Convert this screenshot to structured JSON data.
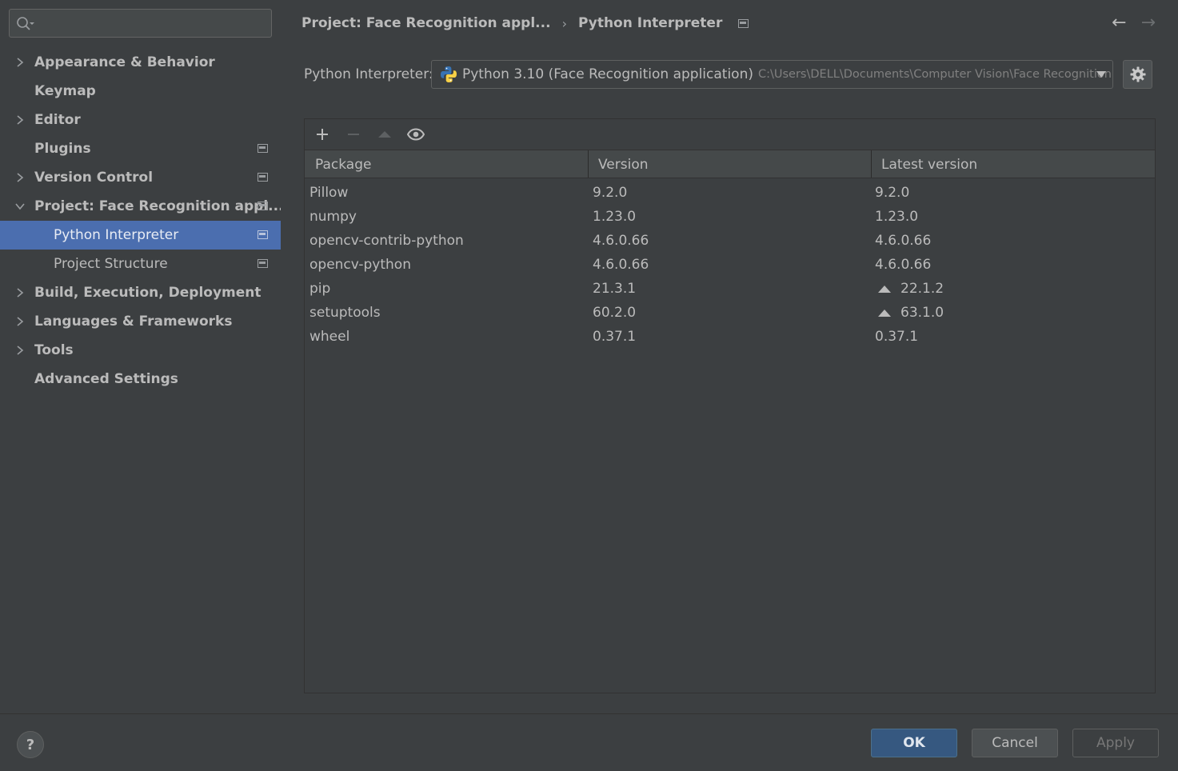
{
  "search": {
    "placeholder": "",
    "value": ""
  },
  "sidebar": {
    "items": [
      {
        "label": "Appearance & Behavior"
      },
      {
        "label": "Keymap"
      },
      {
        "label": "Editor"
      },
      {
        "label": "Plugins"
      },
      {
        "label": "Version Control"
      },
      {
        "label": "Project: Face Recognition appl..."
      },
      {
        "label": "Python Interpreter"
      },
      {
        "label": "Project Structure"
      },
      {
        "label": "Build, Execution, Deployment"
      },
      {
        "label": "Languages & Frameworks"
      },
      {
        "label": "Tools"
      },
      {
        "label": "Advanced Settings"
      }
    ]
  },
  "breadcrumb": {
    "parent": "Project: Face Recognition appl...",
    "current": "Python Interpreter"
  },
  "interpreter": {
    "label": "Python Interpreter:",
    "name": "Python 3.10 (Face Recognition application)",
    "path": "C:\\Users\\DELL\\Documents\\Computer Vision\\Face Recognition a"
  },
  "table": {
    "headers": {
      "package": "Package",
      "version": "Version",
      "latest": "Latest version"
    },
    "rows": [
      {
        "package": "Pillow",
        "version": "9.2.0",
        "latest": "9.2.0",
        "upgrade": false
      },
      {
        "package": "numpy",
        "version": "1.23.0",
        "latest": "1.23.0",
        "upgrade": false
      },
      {
        "package": "opencv-contrib-python",
        "version": "4.6.0.66",
        "latest": "4.6.0.66",
        "upgrade": false
      },
      {
        "package": "opencv-python",
        "version": "4.6.0.66",
        "latest": "4.6.0.66",
        "upgrade": false
      },
      {
        "package": "pip",
        "version": "21.3.1",
        "latest": "22.1.2",
        "upgrade": true
      },
      {
        "package": "setuptools",
        "version": "60.2.0",
        "latest": "63.1.0",
        "upgrade": true
      },
      {
        "package": "wheel",
        "version": "0.37.1",
        "latest": "0.37.1",
        "upgrade": false
      }
    ]
  },
  "footer": {
    "help": "?",
    "ok": "OK",
    "cancel": "Cancel",
    "apply": "Apply"
  },
  "colors": {
    "selection": "#4b6eaf",
    "background": "#3c3f41",
    "ok_button": "#365880"
  }
}
